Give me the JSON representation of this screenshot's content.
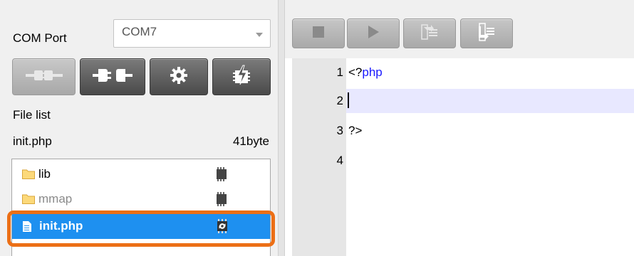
{
  "com_port": {
    "label": "COM Port",
    "value": "COM7"
  },
  "device_buttons": [
    {
      "name": "connect",
      "icon": "plug-connect-icon",
      "enabled": false
    },
    {
      "name": "disconnect",
      "icon": "plug-disconnect-icon",
      "enabled": true
    },
    {
      "name": "settings",
      "icon": "gear-icon",
      "enabled": true
    },
    {
      "name": "flash",
      "icon": "chip-flash-icon",
      "enabled": true
    }
  ],
  "file_list": {
    "label": "File list",
    "selected_file": "init.php",
    "selected_size": "41byte",
    "items": [
      {
        "name": "lib",
        "type": "folder",
        "status_icon": "chip-icon"
      },
      {
        "name": "mmap",
        "type": "folder",
        "status_icon": "chip-icon"
      },
      {
        "name": "init.php",
        "type": "file",
        "status_icon": "chip-sync-icon",
        "selected": true
      }
    ]
  },
  "toolbar": {
    "buttons": [
      "stop",
      "run",
      "step-into",
      "step-over"
    ]
  },
  "editor": {
    "lines": [
      {
        "number": "1",
        "text": "<?php"
      },
      {
        "number": "2",
        "text": ""
      },
      {
        "number": "3",
        "text": "?>"
      },
      {
        "number": "4",
        "text": ""
      }
    ],
    "current_line": 2
  },
  "colors": {
    "selection": "#1e90f0",
    "highlight_ring": "#ec6f16",
    "keyword": "#1a1aff"
  }
}
